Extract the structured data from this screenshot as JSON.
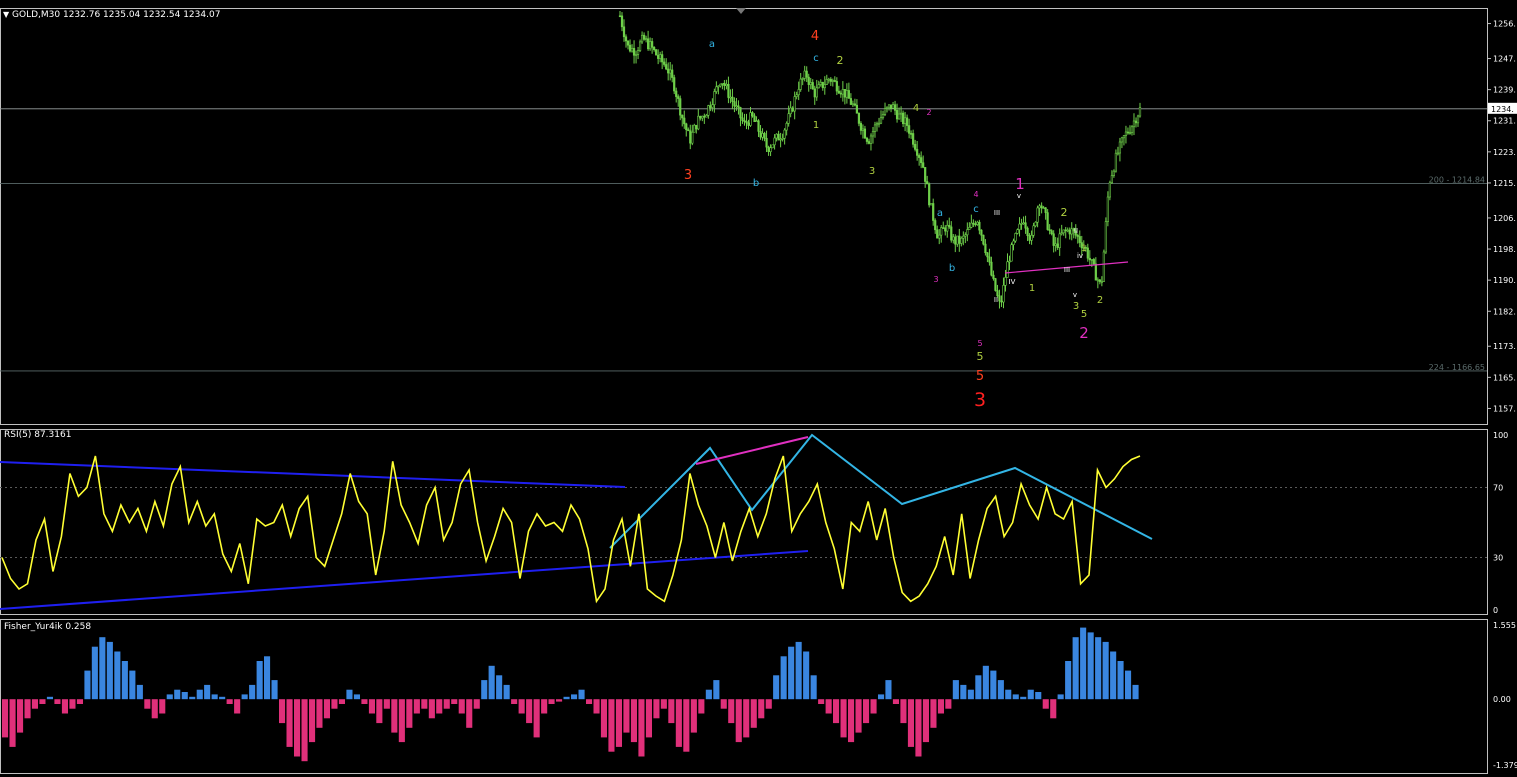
{
  "colors": {
    "background": "#000000",
    "candle": "#6fd04a",
    "rsi_line": "#ffff33",
    "trend_blue": "#1f1ff0",
    "trend_cyan": "#33b5e5",
    "divergence_magenta": "#e030c0",
    "fib_line": "#5a6a6a",
    "hist_pos": "#3a86e0",
    "hist_neg": "#e0307a",
    "axis_text": "#ffffff"
  },
  "header": {
    "main": "GOLD,M30  1232.76 1235.04 1232.54 1234.07",
    "rsi": "RSI(5) 87.3161",
    "fisher": "Fisher_Yur4ik 0.258"
  },
  "chart_data": [
    {
      "type": "candlestick",
      "title": "GOLD,M30",
      "ohlc_last": {
        "open": 1232.76,
        "high": 1235.04,
        "low": 1232.54,
        "close": 1234.07
      },
      "ylim": [
        1153,
        1260
      ],
      "y_ticks": [
        "1256.",
        "1247.",
        "1239.",
        "1231.",
        "1223.",
        "1215.",
        "1206.",
        "1198.",
        "1190.",
        "1182.",
        "1173.",
        "1165.",
        "1157."
      ],
      "y_tick_values": [
        1256,
        1247,
        1239,
        1231,
        1223,
        1215,
        1206,
        1198,
        1190,
        1182,
        1173,
        1165,
        1157
      ],
      "current_price_label": "1234.",
      "current_price": 1234.07,
      "fib_levels": [
        {
          "label": "200 - 1214.84",
          "value": 1214.84
        },
        {
          "label": "224 - 1166.65",
          "value": 1166.65
        }
      ],
      "close_path": [
        1258,
        1250,
        1249,
        1252,
        1250,
        1247,
        1245,
        1240,
        1232,
        1226,
        1231,
        1233,
        1237,
        1242,
        1238,
        1234,
        1230,
        1232,
        1228,
        1224,
        1226,
        1228,
        1233,
        1240,
        1243,
        1238,
        1240,
        1242,
        1240,
        1238,
        1235,
        1230,
        1226,
        1230,
        1233,
        1235,
        1232,
        1230,
        1225,
        1220,
        1209,
        1201,
        1204,
        1200,
        1200,
        1203,
        1206,
        1199,
        1190,
        1183,
        1195,
        1201,
        1206,
        1200,
        1211,
        1205,
        1198,
        1202,
        1203,
        1201,
        1198,
        1193,
        1188,
        1215,
        1222,
        1227,
        1230,
        1234
      ],
      "wave_labels": [
        {
          "t": "4",
          "c": "#ff4020",
          "s": 13
        },
        {
          "t": "c",
          "c": "#33b5e5",
          "s": 10
        },
        {
          "t": "a",
          "c": "#33b5e5",
          "s": 10
        },
        {
          "t": "2",
          "c": "#b0d040",
          "s": 11
        },
        {
          "t": "1",
          "c": "#b0d040",
          "s": 10
        },
        {
          "t": "3",
          "c": "#ff4020",
          "s": 13
        },
        {
          "t": "b",
          "c": "#33b5e5",
          "s": 10
        },
        {
          "t": "4",
          "c": "#b0d040",
          "s": 10
        },
        {
          "t": "2",
          "c": "#e030c0",
          "s": 8
        },
        {
          "t": "3",
          "c": "#b0d040",
          "s": 10
        },
        {
          "t": "a",
          "c": "#33b5e5",
          "s": 10
        },
        {
          "t": "c",
          "c": "#33b5e5",
          "s": 10
        },
        {
          "t": "4",
          "c": "#e030c0",
          "s": 8
        },
        {
          "t": "3",
          "c": "#e030c0",
          "s": 8
        },
        {
          "t": "b",
          "c": "#33b5e5",
          "s": 10
        },
        {
          "t": "III",
          "c": "#ffffff",
          "s": 7
        },
        {
          "t": "II",
          "c": "#ffffff",
          "s": 7
        },
        {
          "t": "1",
          "c": "#e030c0",
          "s": 15
        },
        {
          "t": "v",
          "c": "#ffffff",
          "s": 7
        },
        {
          "t": "IV",
          "c": "#ffffff",
          "s": 7
        },
        {
          "t": "1",
          "c": "#b0d040",
          "s": 10
        },
        {
          "t": "2",
          "c": "#b0d040",
          "s": 11
        },
        {
          "t": "II",
          "c": "#ffffff",
          "s": 7
        },
        {
          "t": "III",
          "c": "#ffffff",
          "s": 7
        },
        {
          "t": "iv",
          "c": "#ffffff",
          "s": 7
        },
        {
          "t": "1",
          "c": "#b0d040",
          "s": 9
        },
        {
          "t": "v",
          "c": "#ffffff",
          "s": 7
        },
        {
          "t": "3",
          "c": "#b0d040",
          "s": 10
        },
        {
          "t": "5",
          "c": "#b0d040",
          "s": 10
        },
        {
          "t": "2",
          "c": "#b0d040",
          "s": 10
        },
        {
          "t": "2",
          "c": "#e030c0",
          "s": 15
        },
        {
          "t": "5",
          "c": "#e030c0",
          "s": 8
        },
        {
          "t": "5",
          "c": "#b0d040",
          "s": 11
        },
        {
          "t": "5",
          "c": "#ff4020",
          "s": 13
        },
        {
          "t": "3",
          "c": "#ff2020",
          "s": 19
        }
      ]
    },
    {
      "type": "line",
      "title": "RSI(5) 87.3161",
      "ylim": [
        0,
        100
      ],
      "y_ticks": [
        "100",
        "70",
        "30",
        "0"
      ],
      "levels": [
        70,
        30
      ],
      "values": [
        30,
        18,
        12,
        15,
        40,
        52,
        22,
        42,
        78,
        65,
        70,
        88,
        55,
        45,
        60,
        50,
        58,
        45,
        62,
        48,
        72,
        82,
        50,
        62,
        48,
        55,
        32,
        22,
        38,
        15,
        52,
        48,
        50,
        60,
        42,
        58,
        65,
        30,
        25,
        40,
        55,
        78,
        62,
        55,
        20,
        45,
        85,
        60,
        50,
        38,
        60,
        70,
        40,
        50,
        72,
        80,
        50,
        28,
        42,
        58,
        50,
        18,
        45,
        55,
        48,
        50,
        45,
        60,
        52,
        35,
        5,
        12,
        40,
        52,
        25,
        55,
        12,
        8,
        5,
        20,
        40,
        78,
        60,
        48,
        30,
        50,
        28,
        45,
        58,
        42,
        55,
        75,
        88,
        45,
        55,
        62,
        72,
        50,
        35,
        12,
        50,
        45,
        62,
        40,
        58,
        30,
        10,
        5,
        8,
        15,
        25,
        42,
        20,
        55,
        18,
        40,
        58,
        65,
        42,
        50,
        72,
        60,
        52,
        70,
        55,
        52,
        62,
        15,
        20,
        80,
        70,
        75,
        82,
        86,
        88
      ]
    },
    {
      "type": "bar",
      "title": "Fisher_Yur4ik 0.258",
      "ylim": [
        -1.379,
        1.555
      ],
      "y_ticks": [
        "1.555",
        "0.00",
        "-1.379"
      ],
      "values": [
        -0.8,
        -1.0,
        -0.7,
        -0.4,
        -0.2,
        -0.1,
        0.05,
        -0.1,
        -0.3,
        -0.2,
        -0.1,
        0.6,
        1.1,
        1.3,
        1.2,
        1.0,
        0.8,
        0.6,
        0.3,
        -0.2,
        -0.4,
        -0.3,
        0.1,
        0.2,
        0.15,
        0.05,
        0.2,
        0.3,
        0.1,
        0.05,
        -0.1,
        -0.3,
        0.1,
        0.3,
        0.8,
        0.9,
        0.4,
        -0.5,
        -1.0,
        -1.2,
        -1.3,
        -0.9,
        -0.6,
        -0.4,
        -0.2,
        -0.1,
        0.2,
        0.1,
        -0.1,
        -0.3,
        -0.5,
        -0.2,
        -0.7,
        -0.9,
        -0.6,
        -0.3,
        -0.2,
        -0.4,
        -0.3,
        -0.2,
        -0.1,
        -0.3,
        -0.6,
        -0.2,
        0.4,
        0.7,
        0.5,
        0.3,
        -0.1,
        -0.3,
        -0.5,
        -0.8,
        -0.3,
        -0.1,
        -0.05,
        0.05,
        0.1,
        0.2,
        -0.1,
        -0.3,
        -0.8,
        -1.1,
        -1.0,
        -0.7,
        -0.9,
        -1.2,
        -0.8,
        -0.4,
        -0.2,
        -0.5,
        -1.0,
        -1.1,
        -0.7,
        -0.3,
        0.2,
        0.4,
        -0.2,
        -0.5,
        -0.9,
        -0.8,
        -0.6,
        -0.4,
        -0.2,
        0.5,
        0.9,
        1.1,
        1.2,
        1.0,
        0.5,
        -0.1,
        -0.3,
        -0.5,
        -0.8,
        -0.9,
        -0.7,
        -0.5,
        -0.3,
        0.1,
        0.4,
        -0.1,
        -0.5,
        -1.0,
        -1.2,
        -0.9,
        -0.6,
        -0.3,
        -0.2,
        0.4,
        0.3,
        0.2,
        0.5,
        0.7,
        0.6,
        0.4,
        0.2,
        0.1,
        0.05,
        0.2,
        0.15,
        -0.2,
        -0.4,
        0.1,
        0.8,
        1.3,
        1.5,
        1.4,
        1.3,
        1.2,
        1.0,
        0.8,
        0.6,
        0.3
      ]
    }
  ]
}
